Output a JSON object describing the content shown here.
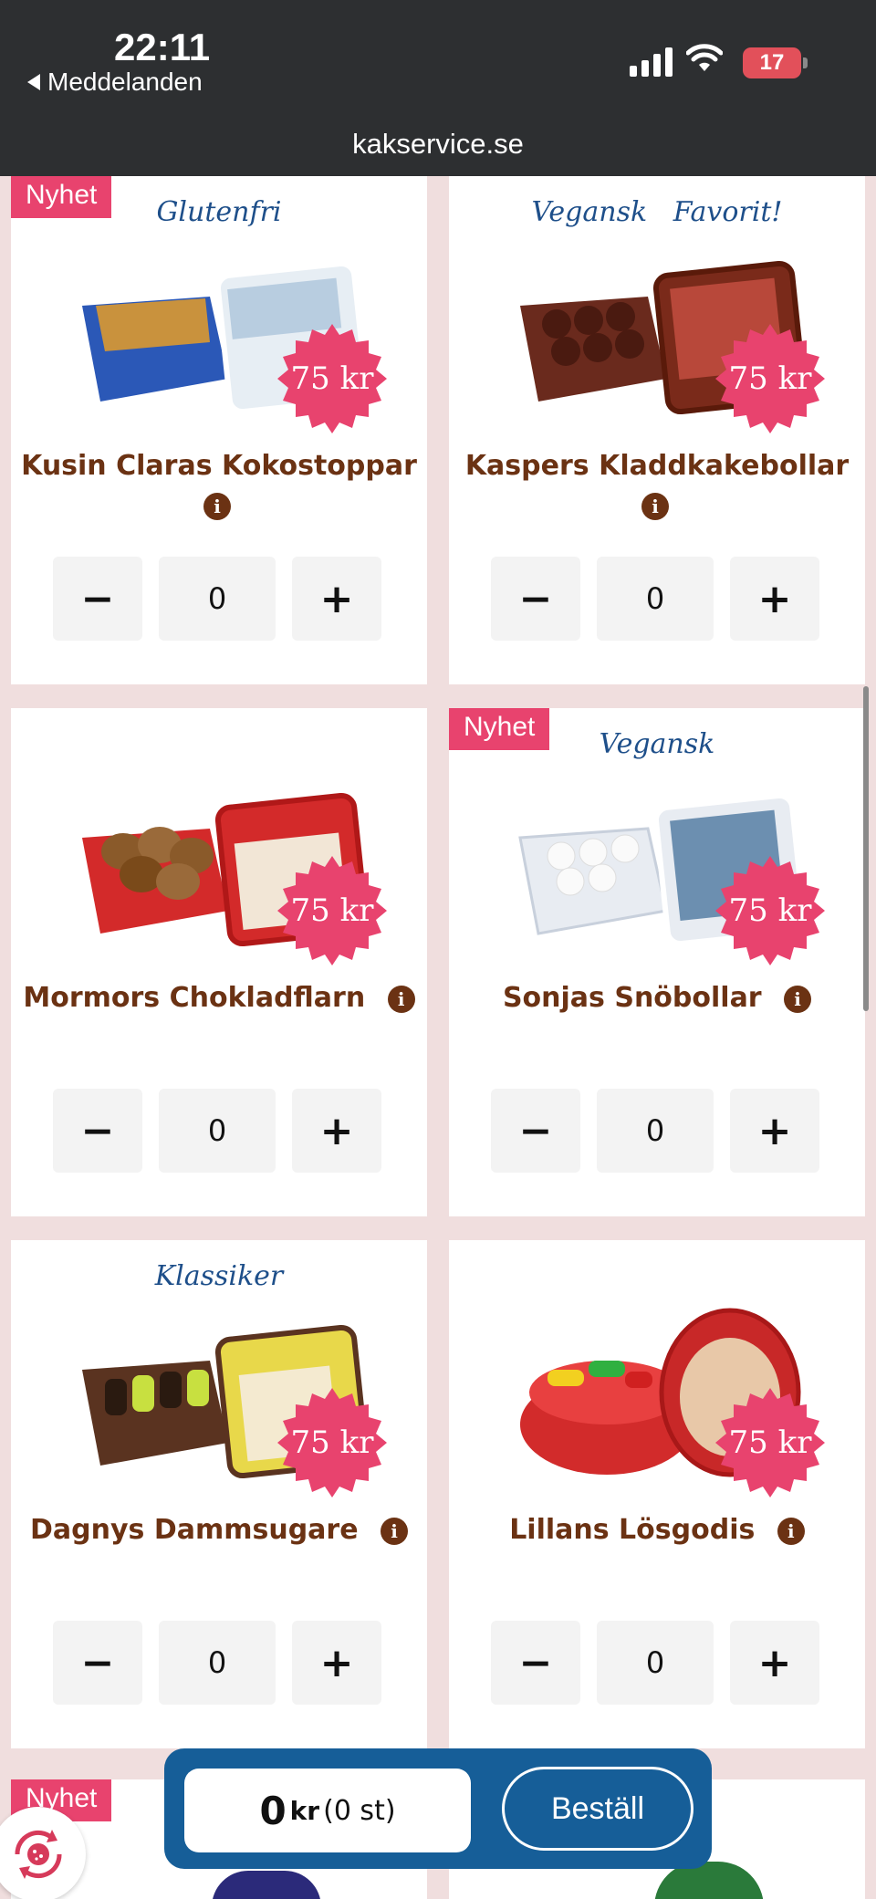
{
  "status_bar": {
    "time": "22:11",
    "back_label": "Meddelanden",
    "battery": "17",
    "url": "kakservice.se"
  },
  "products": [
    {
      "badge": "Nyhet",
      "tagline": "Glutenfri",
      "name": "Kusin Claras Kokostoppar",
      "price": "75 kr",
      "quantity": "0",
      "color": "#2b58b7"
    },
    {
      "badge": "",
      "tagline": "Vegansk   Favorit!",
      "name": "Kaspers Kladdkakebollar",
      "price": "75 kr",
      "quantity": "0",
      "color": "#6a2a1d"
    },
    {
      "badge": "",
      "tagline": "",
      "name": "Mormors Chokladflarn",
      "price": "75 kr",
      "quantity": "0",
      "color": "#d32a2a"
    },
    {
      "badge": "Nyhet",
      "tagline": "Vegansk",
      "name": "Sonjas Snöbollar",
      "price": "75 kr",
      "quantity": "0",
      "color": "#e8ecf2"
    },
    {
      "badge": "",
      "tagline": "Klassiker",
      "name": "Dagnys Dammsugare",
      "price": "75 kr",
      "quantity": "0",
      "color": "#5a3320"
    },
    {
      "badge": "",
      "tagline": "",
      "name": "Lillans Lösgodis",
      "price": "75 kr",
      "quantity": "0",
      "color": "#d22b2b"
    }
  ],
  "partial_card_badge": "Nyhet",
  "order_bar": {
    "amount": "0",
    "unit": "kr",
    "count": "(0 st)",
    "order_label": "Beställ"
  },
  "colors": {
    "accent": "#e8436e",
    "brand_blue": "#165e98",
    "product_name": "#6b3213",
    "background": "#f0dede"
  }
}
